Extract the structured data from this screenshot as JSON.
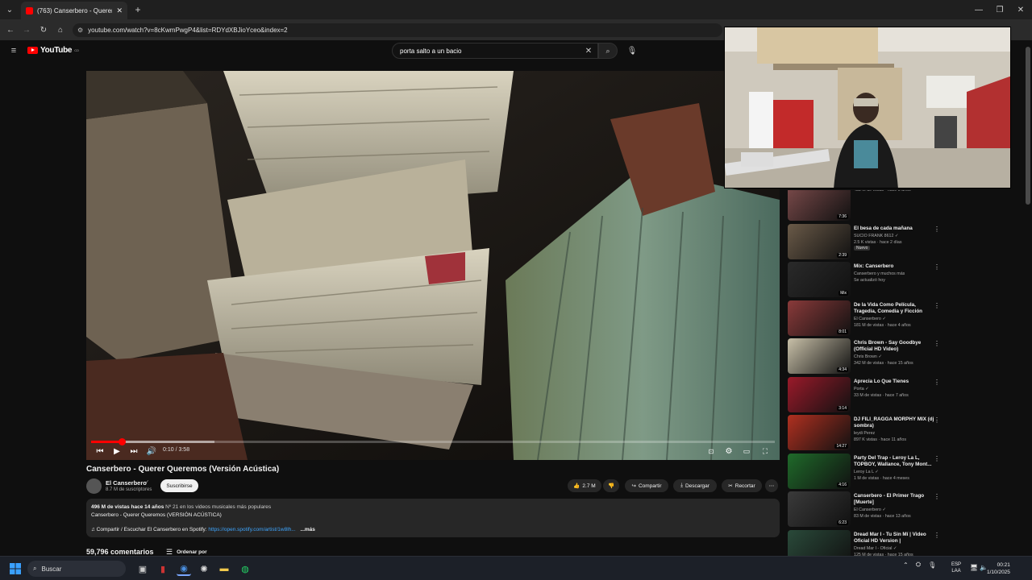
{
  "browser": {
    "tab_title": "(763) Canserbero - Querer Que...",
    "url": "youtube.com/watch?v=8cKwmPwgP4&list=RDYdXBJioYceo&index=2"
  },
  "youtube": {
    "logo_text": "YouTube",
    "logo_sup": "CO",
    "search_query": "porta salto a un bacio"
  },
  "player": {
    "time": "0:10 / 3:58",
    "progress_fraction": 0.045,
    "buffered_fraction": 0.18
  },
  "video": {
    "title": "Canserbero - Querer Queremos (Versión Acústica)",
    "channel": "El Canserbero",
    "subscribers": "8.7 M de suscriptores",
    "subscribe_label": "Suscribirse",
    "likes": "2.7 M",
    "share_label": "Compartir",
    "download_label": "Descargar",
    "clip_label": "Recortar"
  },
  "description": {
    "stats": "496 M de vistas  hace 14 años",
    "rank": "Nº 21 en los videos musicales más populares",
    "line2": "Canserbero - Querer Queremos (VERSIÓN ACÚSTICA)",
    "line3": "♫ Compartir / Escuchar El Canserbero en Spotify: ",
    "link": "https://open.spotify.com/artist/1w8lh...",
    "more": "...más"
  },
  "comments": {
    "count": "59,796 comentarios",
    "sort_label": "Ordenar por"
  },
  "sidebar": {
    "items": [
      {
        "title": "",
        "channel": "",
        "meta": "433 M de vistas · hace 5 años",
        "duration": "7:36",
        "badge": "",
        "thumb": "#7a4a4a"
      },
      {
        "title": "El besa de cada mañana",
        "channel": "SUCIO FRANK 8612 ✓",
        "meta": "2.5 K vistas · hace 2 días",
        "duration": "2:39",
        "badge": "Nuevo",
        "thumb": "#6a5a48"
      },
      {
        "title": "Mix: Canserbero",
        "channel": "Canserbero y muchos más",
        "meta": "Se actualizó hoy",
        "duration": "Mix",
        "badge": "",
        "thumb": "#2a2a2a"
      },
      {
        "title": "De la Vida Como Película, Tragedia, Comedia y Ficción",
        "channel": "El Canserbero ✓",
        "meta": "181 M de vistas · hace 4 años",
        "duration": "8:01",
        "badge": "",
        "thumb": "#8a3a3a"
      },
      {
        "title": "Chris Brown - Say Goodbye (Official HD Video)",
        "channel": "Chris Brown ✓",
        "meta": "342 M de vistas · hace 15 años",
        "duration": "4:34",
        "badge": "",
        "thumb": "#c8c0a8"
      },
      {
        "title": "Aprecia Lo Que Tienes",
        "channel": "Porta ✓",
        "meta": "33 M de vistas · hace 7 años",
        "duration": "3:14",
        "badge": "",
        "thumb": "#9a1a2a"
      },
      {
        "title": "DJ FILI_RAGGA MORPHY MIX (dj sombra)",
        "channel": "leydi Perez",
        "meta": "897 K vistas · hace 11 años",
        "duration": "14:27",
        "badge": "",
        "thumb": "#b03020"
      },
      {
        "title": "Party Del Trap - Leroy La L, TOPBOY, Wallance, Tony Mont...",
        "channel": "Leroy La L ✓",
        "meta": "1 M de vistas · hace 4 meses",
        "duration": "4:16",
        "badge": "",
        "thumb": "#1f6a2a"
      },
      {
        "title": "Canserbero - El Primer Trago [Muerte]",
        "channel": "El Canserbero ✓",
        "meta": "83 M de vistas · hace 13 años",
        "duration": "6:23",
        "badge": "",
        "thumb": "#3a3a3a"
      },
      {
        "title": "Dread Mar I - Tu Sin Mí | Video Oficial HD Version |",
        "channel": "Dread Mar I - Oficial ✓",
        "meta": "125 M de vistas · hace 15 años",
        "duration": "4:14",
        "badge": "",
        "thumb": "#2a4a3a"
      },
      {
        "title": "",
        "channel": "",
        "meta": "",
        "duration": "",
        "badge": "",
        "thumb": "#3a3030"
      }
    ]
  },
  "taskbar": {
    "search_label": "Buscar",
    "lang_top": "ESP",
    "lang_bottom": "LAA",
    "time": "00:21",
    "date": "1/10/2025"
  },
  "colors": {
    "youtube_red": "#ff0000",
    "background": "#0f0f0f",
    "link": "#3ea6ff"
  }
}
